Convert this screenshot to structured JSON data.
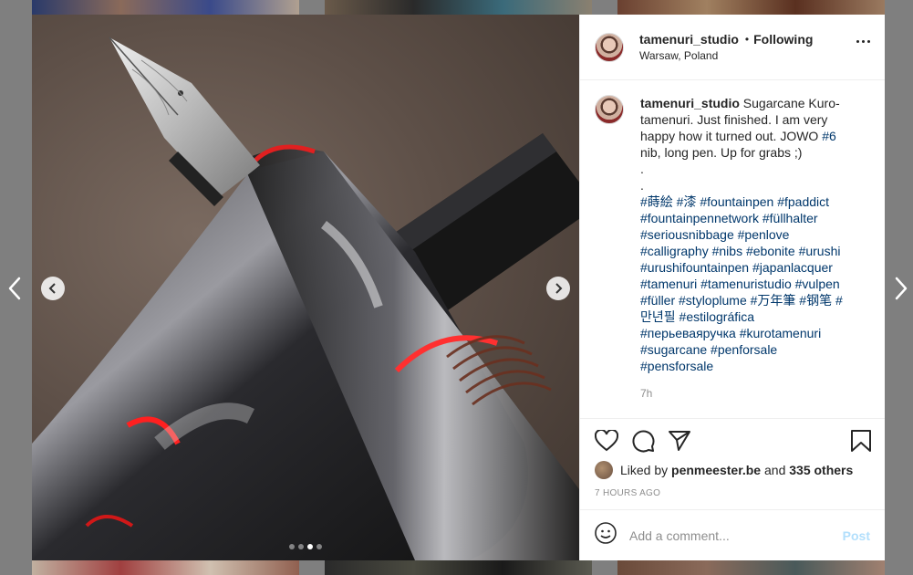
{
  "post": {
    "username": "tamenuri_studio",
    "separator": "•",
    "follow_status": "Following",
    "location": "Warsaw, Poland"
  },
  "caption": {
    "username": "tamenuri_studio",
    "text_before_tag": " Sugarcane Kuro-tamenuri. Just finished. I am very happy how it turned out. JOWO ",
    "inline_tag": "#6",
    "text_after_tag": " nib, long pen. Up for grabs ;)\n.\n.\n",
    "hashtags": "#蒔絵 #漆 #fountainpen #fpaddict #fountainpennetwork #füllhalter #seriousnibbage #penlove #calligraphy #nibs #ebonite #urushi #urushifountainpen #japanlacquer #tamenuri #tamenuristudio #vulpen #füller #styloplume #万年筆 #钢笔 #만년필 #estilográfica #перьеваяручка #kurotamenuri #sugarcane #penforsale #pensforsale",
    "age": "7h"
  },
  "likes": {
    "prefix": "Liked by",
    "user": "penmeester.be",
    "conjunction": "and",
    "others": "335 others"
  },
  "timestamp": "7 HOURS AGO",
  "comment": {
    "placeholder": "Add a comment...",
    "post_label": "Post"
  },
  "carousel": {
    "total": 4,
    "active_index": 2
  },
  "icons": {
    "like": "heart-icon",
    "comment": "comment-bubble-icon",
    "share": "paper-plane-icon",
    "save": "bookmark-icon",
    "emoji": "smiley-icon",
    "more": "more-options-icon"
  },
  "colors": {
    "link": "#00376b",
    "post_button": "#b2dffc",
    "muted": "#8e8e8e"
  }
}
